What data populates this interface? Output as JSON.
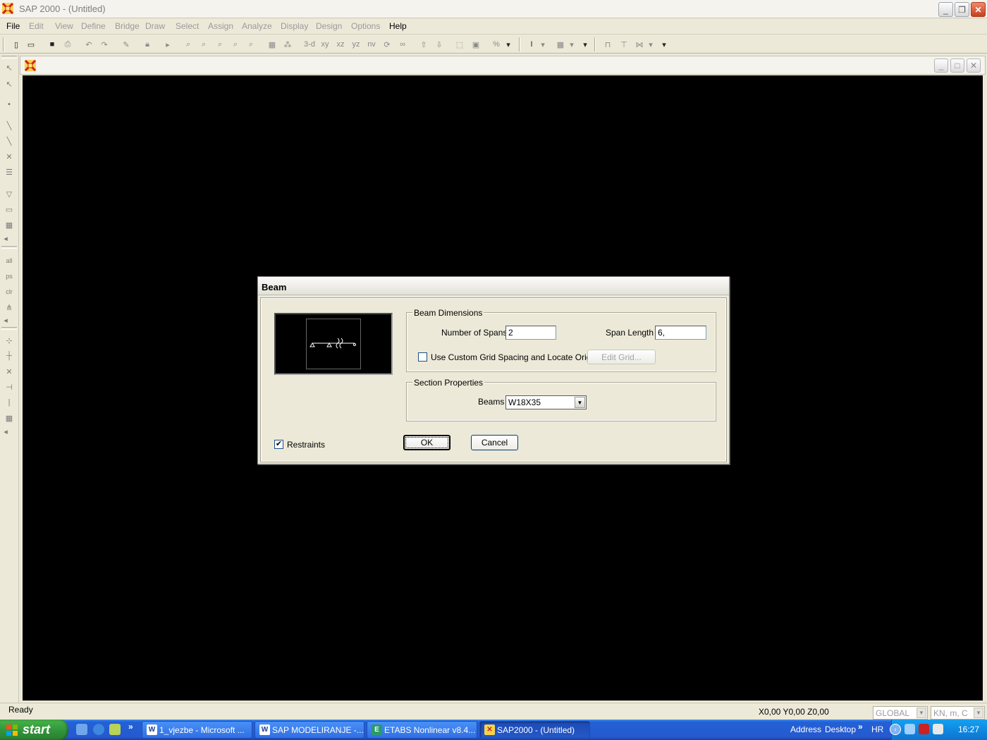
{
  "window": {
    "title": "SAP 2000 - (Untitled)",
    "caption_buttons": [
      "minimize",
      "restore",
      "close"
    ]
  },
  "menu": [
    {
      "label": "File",
      "enabled": true
    },
    {
      "label": "Edit",
      "enabled": false
    },
    {
      "label": "View",
      "enabled": false
    },
    {
      "label": "Define",
      "enabled": false
    },
    {
      "label": "Bridge",
      "enabled": false
    },
    {
      "label": "Draw",
      "enabled": false
    },
    {
      "label": "Select",
      "enabled": false
    },
    {
      "label": "Assign",
      "enabled": false
    },
    {
      "label": "Analyze",
      "enabled": false
    },
    {
      "label": "Display",
      "enabled": false
    },
    {
      "label": "Design",
      "enabled": false
    },
    {
      "label": "Options",
      "enabled": false
    },
    {
      "label": "Help",
      "enabled": true
    }
  ],
  "toolbar": {
    "view_3d": "3-d",
    "view_xy": "xy",
    "view_xz": "xz",
    "view_yz": "yz",
    "view_nv": "nv"
  },
  "left_toolbar": {
    "all_label": "all",
    "ps_label": "ps",
    "clr_label": "clr"
  },
  "dialog": {
    "title": "Beam",
    "beam_dimensions": {
      "legend": "Beam Dimensions",
      "num_spans_label": "Number of Spans",
      "num_spans_value": "2",
      "span_length_label": "Span Length",
      "span_length_value": "6,",
      "custom_grid_label": "Use Custom Grid Spacing and Locate Origin",
      "custom_grid_checked": false,
      "edit_grid_label": "Edit Grid..."
    },
    "section_properties": {
      "legend": "Section Properties",
      "beams_label": "Beams",
      "beams_value": "W18X35"
    },
    "restraints_label": "Restraints",
    "restraints_checked": true,
    "ok_label": "OK",
    "cancel_label": "Cancel"
  },
  "status": {
    "text": "Ready",
    "coords": "X0,00  Y0,00  Z0,00",
    "coord_system": "GLOBAL",
    "units": "KN, m, C"
  },
  "taskbar": {
    "start_label": "start",
    "tasks": [
      {
        "label": "1_vjezbe - Microsoft ...",
        "icon": "word-icon",
        "active": false
      },
      {
        "label": "SAP  MODELIRANJE -...",
        "icon": "word-icon",
        "active": false
      },
      {
        "label": "ETABS Nonlinear v8.4...",
        "icon": "etabs-icon",
        "active": false
      },
      {
        "label": "SAP2000 - (Untitled)",
        "icon": "sap-icon",
        "active": true
      }
    ],
    "address_label": "Address",
    "desktop_label": "Desktop",
    "language": "HR",
    "clock": "16:27",
    "chevron": "»"
  },
  "colors": {
    "canvas_bg": "#000000",
    "taskbar_blue": "#2559d0",
    "start_green": "#32943a"
  }
}
